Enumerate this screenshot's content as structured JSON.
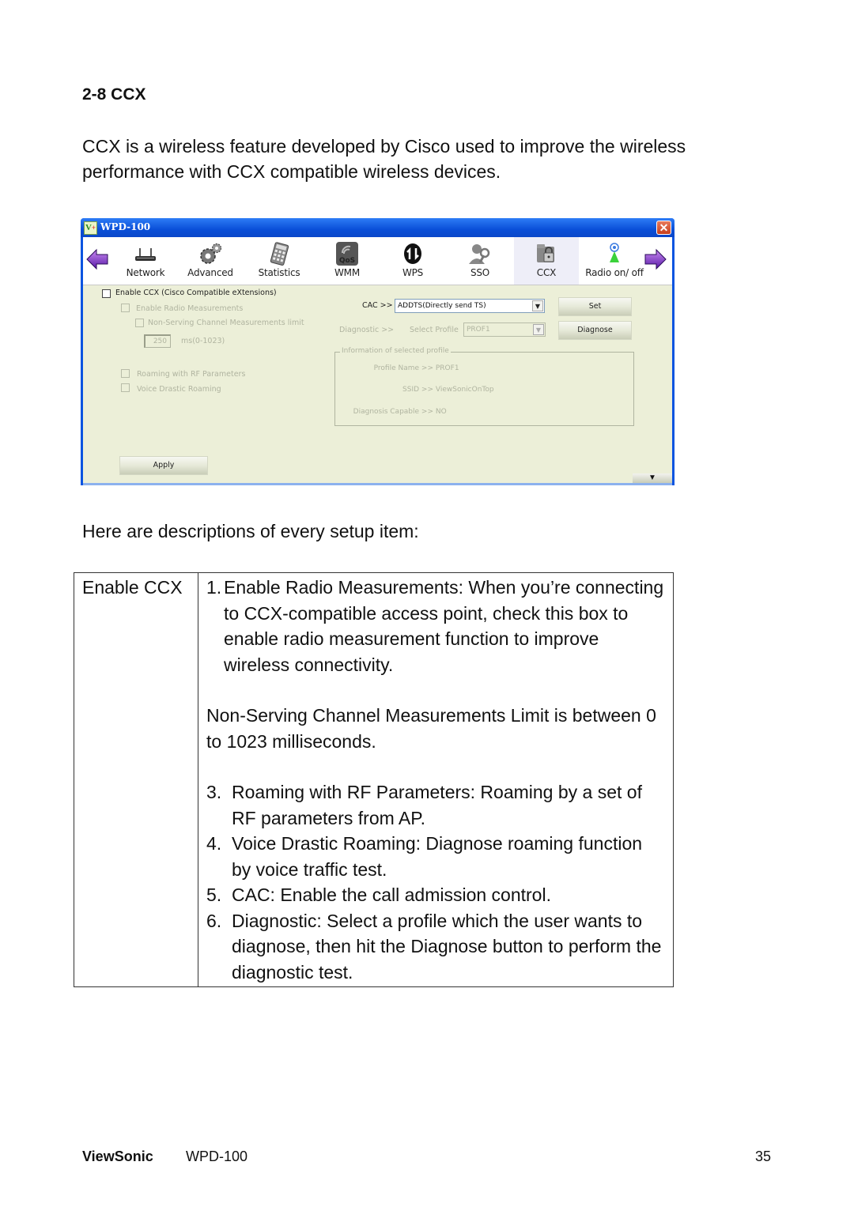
{
  "section": {
    "heading": "2-8 CCX",
    "intro": "CCX is a wireless feature developed by Cisco used to improve the wireless performance with CCX compatible wireless devices."
  },
  "window": {
    "title": "WPD-100",
    "logo_text": "V",
    "logo_plus": "+",
    "close_symbol": "✕",
    "toolbar": [
      {
        "label": "Network",
        "icon": "router-icon"
      },
      {
        "label": "Advanced",
        "icon": "gears-icon"
      },
      {
        "label": "Statistics",
        "icon": "calculator-icon"
      },
      {
        "label": "WMM",
        "icon": "qos-icon"
      },
      {
        "label": "WPS",
        "icon": "wps-icon"
      },
      {
        "label": "SSO",
        "icon": "user-key-icon"
      },
      {
        "label": "CCX",
        "icon": "folder-lock-icon",
        "active": true
      },
      {
        "label": "Radio on/ off",
        "icon": "antenna-icon"
      }
    ],
    "ccx": {
      "enable_label": "Enable CCX (Cisco Compatible eXtensions)",
      "enable_checked": false,
      "radio_measurements_label": "Enable Radio Measurements",
      "non_serving_label": "Non-Serving Channel Measurements limit",
      "limit_value": "250",
      "limit_unit": "ms(0-1023)",
      "roaming_rf_label": "Roaming with RF Parameters",
      "voice_roaming_label": "Voice Drastic Roaming",
      "cac_label": "CAC >>",
      "cac_value": "ADDTS(Directly send TS)",
      "set_button": "Set",
      "diagnostic_label": "Diagnostic >>",
      "select_profile_label": "Select Profile",
      "profile_value": "PROF1",
      "diagnose_button": "Diagnose",
      "info_legend": "Information of selected profile",
      "info": [
        {
          "key": "Profile Name >>",
          "value": "PROF1"
        },
        {
          "key": "SSID >>",
          "value": "ViewSonicOnTop"
        },
        {
          "key": "Diagnosis Capable >>",
          "value": "NO"
        }
      ],
      "apply_button": "Apply",
      "scroll_symbol": "▼"
    }
  },
  "descriptions": {
    "intro": "Here are descriptions of every setup item:",
    "item_name": "Enable CCX",
    "items": [
      {
        "num": "1.",
        "text": "Enable Radio Measurements: When you’re connecting to CCX-compatible access point, check this box to enable radio measurement function to improve wireless connectivity."
      },
      {
        "num": "",
        "text": "Non-Serving Channel Measurements Limit is between 0 to 1023 milliseconds."
      },
      {
        "num": "3.",
        "text": "Roaming with RF Parameters: Roaming by a set of RF parameters from AP."
      },
      {
        "num": "4.",
        "text": "Voice Drastic Roaming: Diagnose roaming function by voice traffic test."
      },
      {
        "num": "5.",
        "text": "CAC: Enable the call admission control."
      },
      {
        "num": "6.",
        "text": "Diagnostic: Select a profile which the user wants to diagnose, then hit the Diagnose button to perform the diagnostic test."
      }
    ]
  },
  "footer": {
    "brand": "ViewSonic",
    "model": "WPD-100",
    "page": "35"
  }
}
